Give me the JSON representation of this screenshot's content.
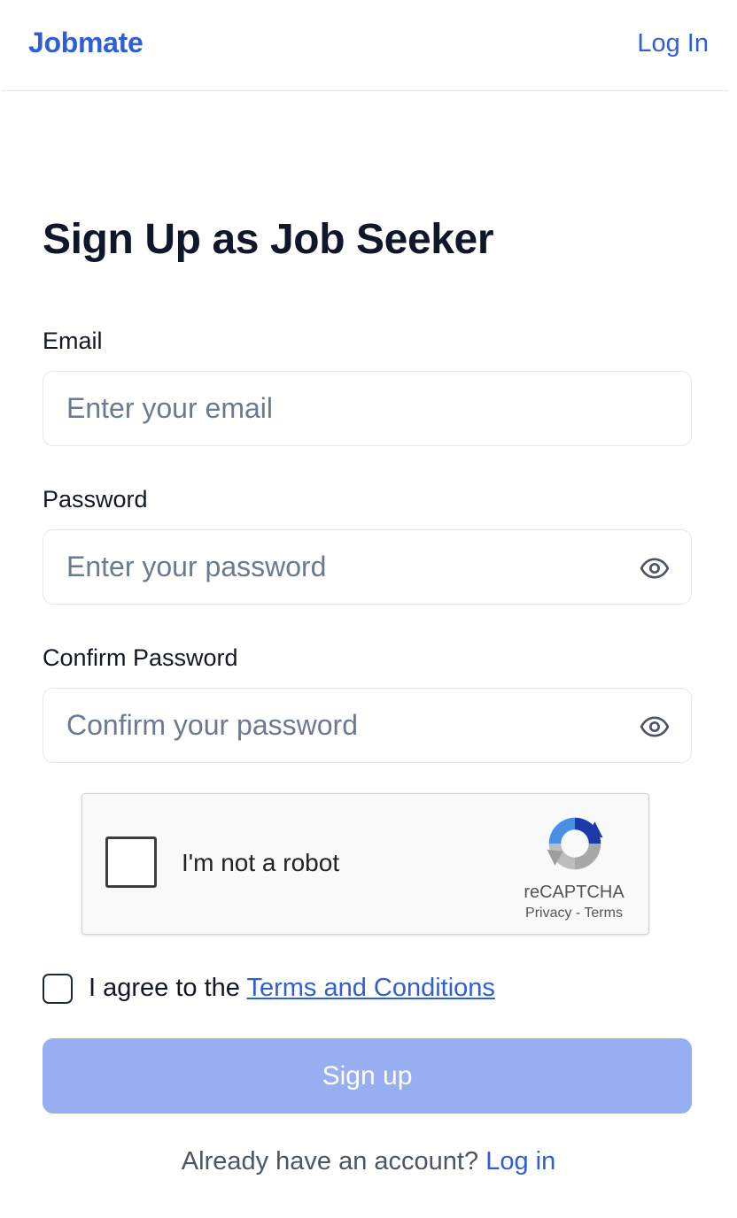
{
  "header": {
    "brand": "Jobmate",
    "login_label": "Log In"
  },
  "form": {
    "title": "Sign Up as Job Seeker",
    "email": {
      "label": "Email",
      "placeholder": "Enter your email",
      "value": ""
    },
    "password": {
      "label": "Password",
      "placeholder": "Enter your password",
      "value": ""
    },
    "confirm_password": {
      "label": "Confirm Password",
      "placeholder": "Confirm your password",
      "value": ""
    },
    "recaptcha": {
      "label": "I'm not a robot",
      "brand": "reCAPTCHA",
      "privacy": "Privacy",
      "separator": " - ",
      "terms": "Terms",
      "checked": false
    },
    "agree": {
      "prefix": "I agree to the ",
      "link": "Terms and Conditions",
      "checked": false
    },
    "submit_label": "Sign up",
    "submit_disabled": true
  },
  "footer": {
    "prompt": "Already have an account? ",
    "link": "Log in"
  },
  "icons": {
    "password_toggle": "eye-icon",
    "confirm_toggle": "eye-icon",
    "recaptcha_logo": "recaptcha-logo-icon"
  },
  "colors": {
    "brand": "#2f5fd6",
    "button_disabled": "#97aff0",
    "border": "#e5e7eb",
    "placeholder": "#6b7a90"
  }
}
